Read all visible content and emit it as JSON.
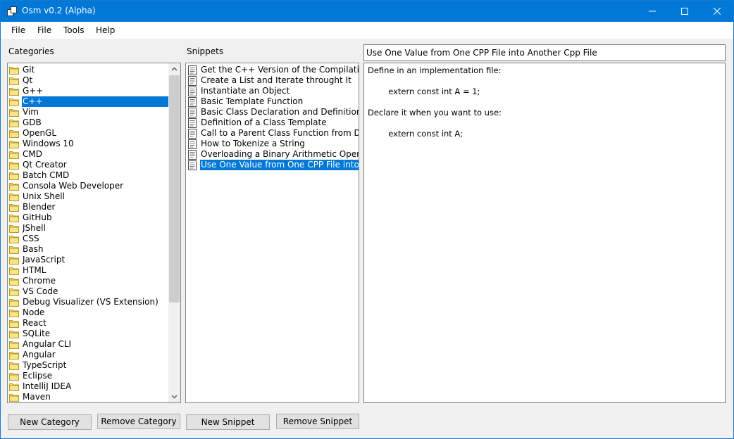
{
  "window": {
    "title": "Osm v0.2 (Alpha)",
    "minimize": "minimize",
    "maximize": "maximize",
    "close": "close"
  },
  "menu": [
    "File",
    "File",
    "Tools",
    "Help"
  ],
  "categories": {
    "label": "Categories",
    "selected": "C++",
    "items": [
      "Git",
      "Qt",
      "G++",
      "C++",
      "Vim",
      "GDB",
      "OpenGL",
      "Windows 10",
      "CMD",
      "Qt Creator",
      "Batch CMD",
      "Consola Web Developer",
      "Unix Shell",
      "Blender",
      "GitHub",
      "JShell",
      "CSS",
      "Bash",
      "JavaScript",
      "HTML",
      "Chrome",
      "VS Code",
      "Debug Visualizer (VS Extension)",
      "Node",
      "React",
      "SQLite",
      "Angular CLI",
      "Angular",
      "TypeScript",
      "Eclipse",
      "IntelliJ IDEA",
      "Maven"
    ]
  },
  "snippets": {
    "label": "Snippets",
    "selected": "Use One Value from One CPP File into Ar",
    "items": [
      "Get the C++ Version of the Compilation",
      "Create a List and Iterate throught It",
      "Instantiate an Object",
      "Basic Template Function",
      "Basic Class Declaration and Definition in th",
      "Definition of a Class Template",
      "Call to a Parent Class Function from Derive",
      "How to Tokenize a String",
      "Overloading a Binary Arithmetic Operator",
      "Use One Value from One CPP File into Ar"
    ]
  },
  "snippet_title": "Use One Value from One CPP File into Another Cpp File",
  "snippet_body": "Define in an implementation file:\n\n        extern const int A = 1;\n\nDeclare it when you want to use:\n\n        extern const int A;",
  "buttons": {
    "new_category": "New Category",
    "remove_category": "Remove Category",
    "new_snippet": "New Snippet",
    "remove_snippet": "Remove Snippet"
  },
  "colors": {
    "titlebar": "#0078d7",
    "selection": "#0078d7",
    "folder": "#f5d96b"
  },
  "icons": {
    "folder": "folder-icon",
    "snippet": "document-icon"
  }
}
